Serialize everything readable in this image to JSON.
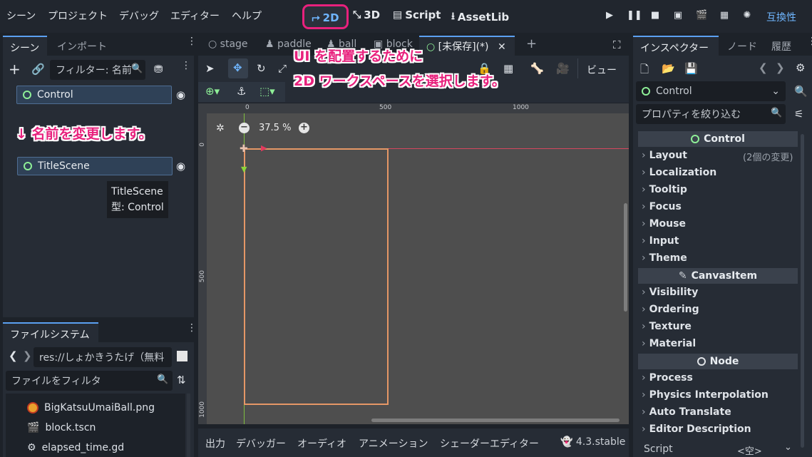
{
  "menu": [
    "シーン",
    "プロジェクト",
    "デバッグ",
    "エディター",
    "ヘルプ"
  ],
  "workspaces": {
    "w2d": "2D",
    "w3d": "3D",
    "script": "Script",
    "assetlib": "AssetLib"
  },
  "renderer": "互換性",
  "scene_dock": {
    "tabs": [
      "シーン",
      "インポート"
    ],
    "filter_placeholder": "フィルター: 名前",
    "nodes": [
      {
        "name": "Control"
      },
      {
        "name": "TitleScene"
      }
    ],
    "tooltip_line1": "TitleScene",
    "tooltip_line2": "型: Control"
  },
  "annotations": {
    "rename": "↓ 名前を変更します。",
    "ui_line1": "UI を配置するために",
    "ui_line2": "2D ワークスペースを選択します。"
  },
  "filesystem": {
    "title": "ファイルシステム",
    "path": "res://しょかきうたげ（無料",
    "filter_placeholder": "ファイルをフィルタ",
    "files": [
      {
        "name": "BigKatsuUmaiBall.png",
        "icon": "image-icon"
      },
      {
        "name": "block.tscn",
        "icon": "scene-icon"
      },
      {
        "name": "elapsed_time.gd",
        "icon": "gear-icon"
      }
    ]
  },
  "editor_tabs": [
    {
      "label": "stage"
    },
    {
      "label": "paddle"
    },
    {
      "label": "ball"
    },
    {
      "label": "block"
    },
    {
      "label": "[未保存](*)"
    }
  ],
  "toolbar": {
    "view_label": "ビュー"
  },
  "viewport": {
    "zoom": "37.5 %",
    "ruler_h": [
      "0",
      "500",
      "1000"
    ],
    "ruler_v": [
      "0",
      "500",
      "1000"
    ]
  },
  "bottom_tabs": [
    "出力",
    "デバッガー",
    "オーディオ",
    "アニメーション",
    "シェーダーエディター"
  ],
  "version": "4.3.stable",
  "inspector": {
    "tabs": [
      "インスペクター",
      "ノード",
      "履歴"
    ],
    "node_select": "Control",
    "filter_placeholder": "プロパティを絞り込む",
    "section_control": "Control",
    "control_props": [
      {
        "name": "Layout",
        "note": "(2個の変更)"
      },
      {
        "name": "Localization"
      },
      {
        "name": "Tooltip"
      },
      {
        "name": "Focus"
      },
      {
        "name": "Mouse"
      },
      {
        "name": "Input"
      },
      {
        "name": "Theme"
      }
    ],
    "section_canvas": "CanvasItem",
    "canvas_props": [
      "Visibility",
      "Ordering",
      "Texture",
      "Material"
    ],
    "section_node": "Node",
    "node_props": [
      "Process",
      "Physics Interpolation",
      "Auto Translate",
      "Editor Description"
    ],
    "script_label": "Script",
    "script_value": "<空>"
  },
  "colors": {
    "accent": "#5ba0f2",
    "annotation": "#e8217d",
    "control_green": "#8eef97",
    "rect_orange": "#e59766"
  }
}
